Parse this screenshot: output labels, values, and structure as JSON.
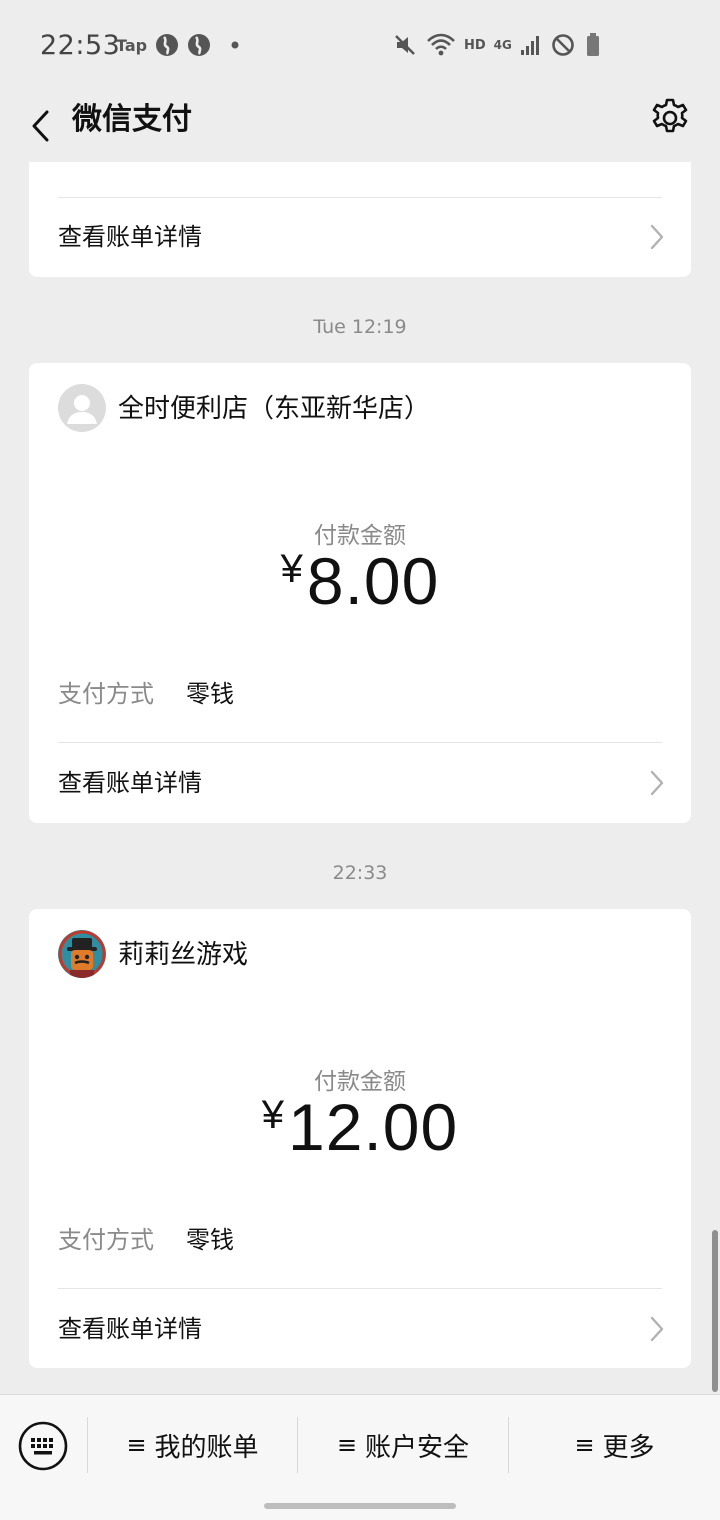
{
  "status_bar": {
    "time": "22:53",
    "tap_label": "Tap",
    "hd_label": "HD",
    "network_label": "4G",
    "icons": [
      "tap-app-icon",
      "browser-globe-icon",
      "browser-globe-icon",
      "notification-dot-icon",
      "mute-icon",
      "wifi-icon",
      "signal-icon",
      "do-not-disturb-icon",
      "battery-icon"
    ]
  },
  "header": {
    "title": "微信支付",
    "back_icon": "chevron-left-icon",
    "settings_icon": "gear-icon"
  },
  "feed": {
    "partial_card": {
      "detail_label": "查看账单详情"
    },
    "transactions": [
      {
        "timestamp": "Tue 12:19",
        "merchant": "全时便利店（东亚新华店）",
        "avatar_icon": "default-user-avatar-icon",
        "amount_caption": "付款金额",
        "currency": "¥",
        "amount": "8.00",
        "pay_method_label": "支付方式",
        "pay_method_value": "零钱",
        "detail_label": "查看账单详情"
      },
      {
        "timestamp": "22:33",
        "merchant": "莉莉丝游戏",
        "avatar_icon": "game-character-avatar-icon",
        "amount_caption": "付款金额",
        "currency": "¥",
        "amount": "12.00",
        "pay_method_label": "支付方式",
        "pay_method_value": "零钱",
        "detail_label": "查看账单详情"
      }
    ]
  },
  "bottom_menu": {
    "keyboard_icon": "keyboard-icon",
    "items": [
      {
        "label": "我的账单"
      },
      {
        "label": "账户安全"
      },
      {
        "label": "更多"
      }
    ],
    "menu_glyph": "≡"
  },
  "colors": {
    "background": "#ededed",
    "card": "#ffffff",
    "secondary_text": "#8a8a8a",
    "primary_text": "#111111"
  }
}
